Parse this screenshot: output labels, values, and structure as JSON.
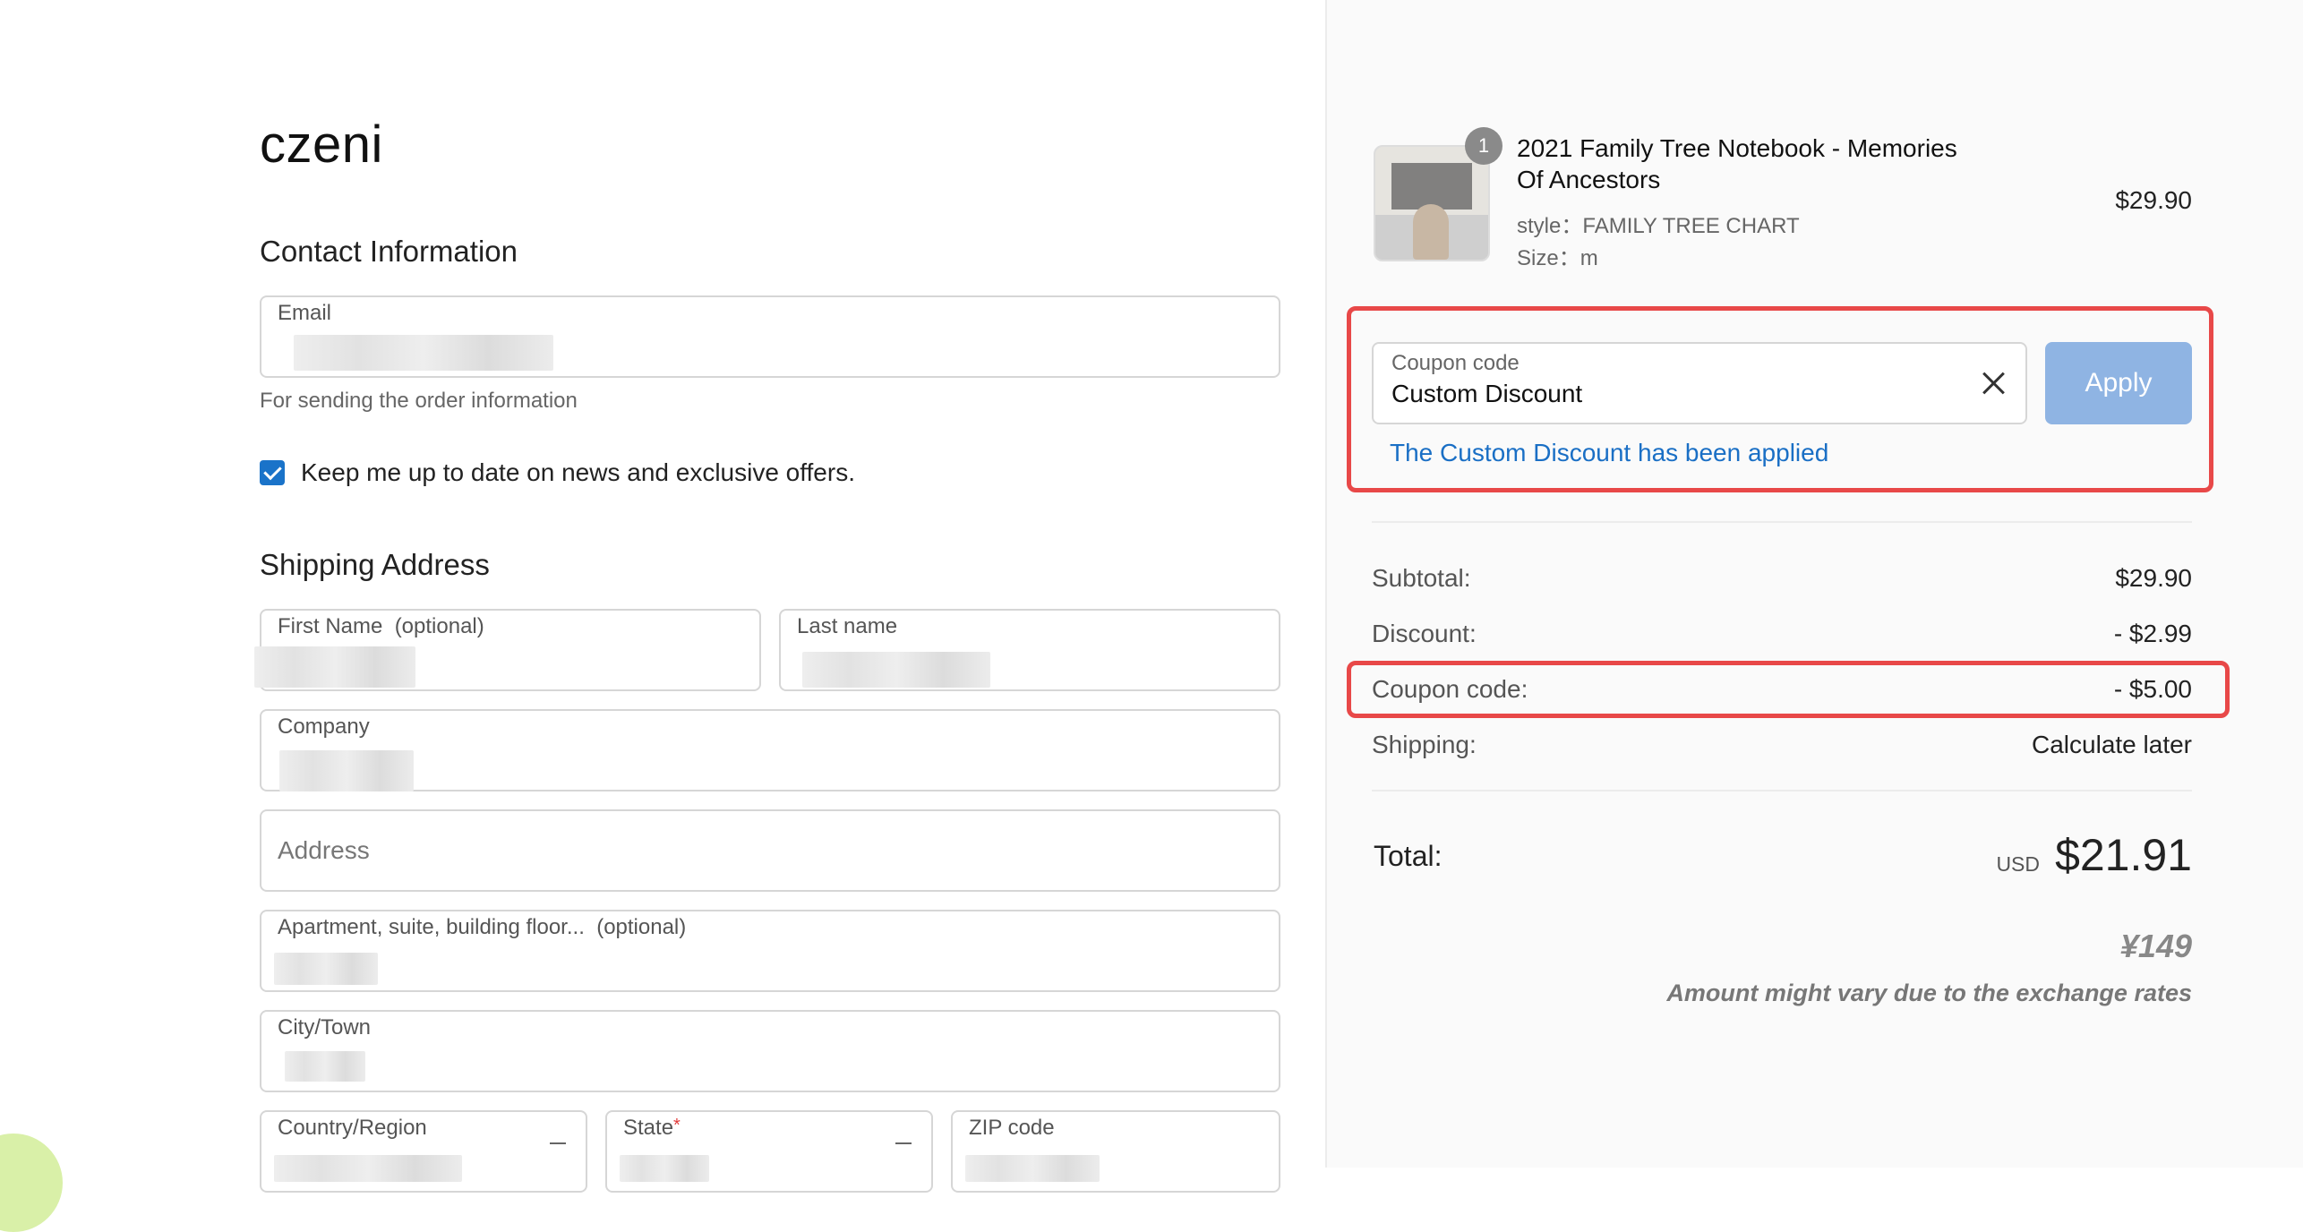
{
  "brand": "czeni",
  "contact": {
    "title": "Contact Information",
    "email_label": "Email",
    "email_helper": "For sending the order information",
    "newsletter_label": "Keep me up to date on news and exclusive offers."
  },
  "shipping": {
    "title": "Shipping Address",
    "first_name_label": "First Name",
    "first_name_optional": "(optional)",
    "last_name_label": "Last name",
    "company_label": "Company",
    "address_placeholder": "Address",
    "apartment_label": "Apartment, suite, building floor...",
    "apartment_optional": "(optional)",
    "city_label": "City/Town",
    "country_label": "Country/Region",
    "state_label": "State",
    "zip_label": "ZIP code"
  },
  "product": {
    "qty": "1",
    "title": "2021 Family Tree Notebook - Memories Of Ancestors",
    "style_label": "style：",
    "style_value": "FAMILY TREE CHART",
    "size_label": "Size：",
    "size_value": "m",
    "price": "$29.90"
  },
  "coupon": {
    "label": "Coupon code",
    "value": "Custom Discount",
    "apply_label": "Apply",
    "message": "The Custom Discount has been applied"
  },
  "summary": {
    "subtotal_label": "Subtotal:",
    "subtotal_value": "$29.90",
    "discount_label": "Discount:",
    "discount_value": "- $2.99",
    "coupon_label": "Coupon code:",
    "coupon_value": "- $5.00",
    "shipping_label": "Shipping:",
    "shipping_value": "Calculate later"
  },
  "total": {
    "label": "Total:",
    "currency": "USD",
    "value": "$21.91",
    "local_value": "¥149",
    "note": "Amount might vary due to the exchange rates"
  },
  "colors": {
    "accent_blue": "#1a73c9",
    "apply_button": "#8fb4e3",
    "highlight_red": "#e84848"
  }
}
